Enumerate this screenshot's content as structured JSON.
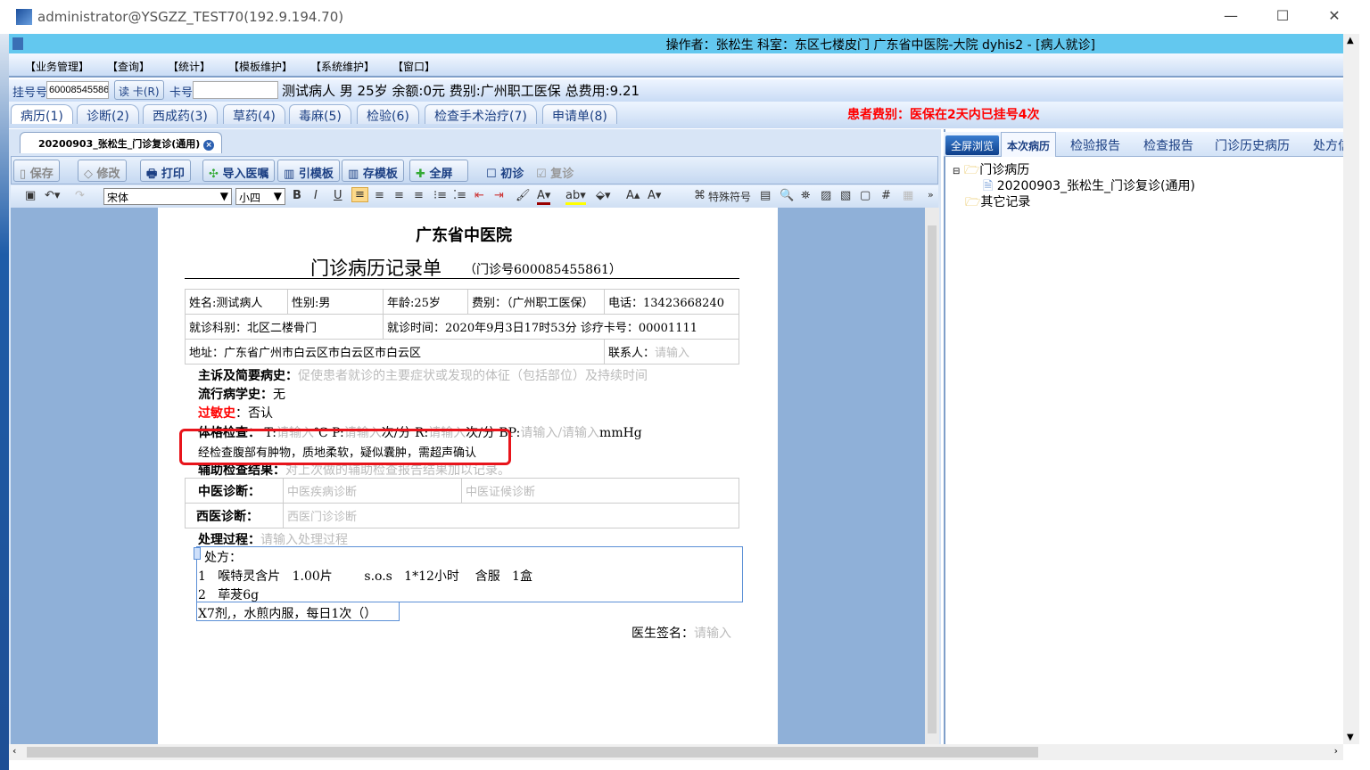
{
  "window": {
    "title": "administrator@YSGZZ_TEST70(192.9.194.70)",
    "minimize": "—",
    "maximize": "☐",
    "close": "✕"
  },
  "app": {
    "header": "操作者：张松生  科室：东区七楼皮门  广东省中医院-大院 dyhis2 - [病人就诊]"
  },
  "menu": [
    "【业务管理】",
    "【查询】",
    "【统计】",
    "【模板维护】",
    "【系统维护】",
    "【窗口】"
  ],
  "patient": {
    "reg_label": "挂号号",
    "reg_value": "60008545586",
    "read_card": "读 卡(R)",
    "card_label": "卡号",
    "card_value": "",
    "summary": "测试病人  男  25岁  余额:0元  费别:广州职工医保  总费用:9.21"
  },
  "tabs": [
    "病历(1)",
    "诊断(2)",
    "西成药(3)",
    "草药(4)",
    "毒麻(5)",
    "检验(6)",
    "检查手术治疗(7)",
    "申请单(8)"
  ],
  "notice": "患者费别：医保在2天内已挂号4次",
  "doc_tab": "20200903_张松生_门诊复诊(通用)",
  "toolbar": {
    "save": "保存",
    "edit": "修改",
    "print": "打印",
    "import": "导入医嘱",
    "ref_tpl": "引模板",
    "save_tpl": "存模板",
    "fullscreen": "全屏",
    "first_visit": "初诊",
    "return_visit": "复诊",
    "first_checked": false,
    "return_checked": true
  },
  "format": {
    "font": "宋体",
    "size": "小四",
    "special": "特殊符号"
  },
  "document": {
    "hospital": "广东省中医院",
    "title": "门诊病历记录单",
    "visit_no": "（门诊号600085455861）",
    "name": "姓名:测试病人",
    "sex": "性别:男",
    "age": "年龄:25岁",
    "fee": "费别：（广州职工医保）",
    "phone": "电话：13423668240",
    "dept": "就诊科别：北区二楼骨门",
    "time": "就诊时间：2020年9月3日17时53分  诊疗卡号：00001111",
    "address": "地址：广东省广州市白云区市白云区市白云区",
    "contact_label": "联系人：",
    "contact_ph": "请输入",
    "complaint_label": "主诉及简要病史：",
    "complaint_ph": "促使患者就诊的主要症状或发现的体征（包括部位）及持续时间",
    "epi_label": "流行病学史：",
    "epi_value": "无",
    "allergy_label": "过敏史",
    "allergy_value": "：否认",
    "exam_label": "体格检查：",
    "exam_t": "T:",
    "exam_t_ph": "请输入",
    "exam_t_unit": "℃",
    "exam_p": "P:",
    "exam_p_ph": "请输入",
    "exam_p_unit": "次/分",
    "exam_r": "R:",
    "exam_r_ph": "请输入",
    "exam_r_unit": "次/分",
    "exam_bp": "BP:",
    "exam_bp_ph": "请输入/请输入",
    "exam_bp_unit": "mmHg",
    "exam_note": "经检查腹部有肿物，质地柔软，疑似囊肿，需超声确认",
    "aux_label": "辅助检查结果：",
    "aux_ph": "对上次做的辅助检查报告结果加以记录。",
    "tcm_label": "中医诊断：",
    "tcm_ph1": "中医疾病诊断",
    "tcm_ph2": "中医证候诊断",
    "wm_label": "西医诊断：",
    "wm_ph": "西医门诊诊断",
    "proc_label": "处理过程：",
    "proc_ph": "请输入处理过程",
    "rx_label": "处方：",
    "rx_lines": [
      "1   喉特灵含片   1.00片        s.o.s   1*12小时    含服   1盒",
      "2   荜茇6g",
      "X7剂,，水煎内服，每日1次（）"
    ],
    "sign_label": "医生签名：",
    "sign_ph": "请输入"
  },
  "right": {
    "tabs": [
      "全屏浏览",
      "本次病历",
      "检验报告",
      "检查报告",
      "门诊历史病历",
      "处方信"
    ],
    "tree": {
      "root": "门诊病历",
      "child": "20200903_张松生_门诊复诊(通用)",
      "other": "其它记录"
    }
  },
  "colors": {
    "header": "#63c8ef",
    "notice": "#ff0000",
    "highlight_box": "#e8141b"
  }
}
